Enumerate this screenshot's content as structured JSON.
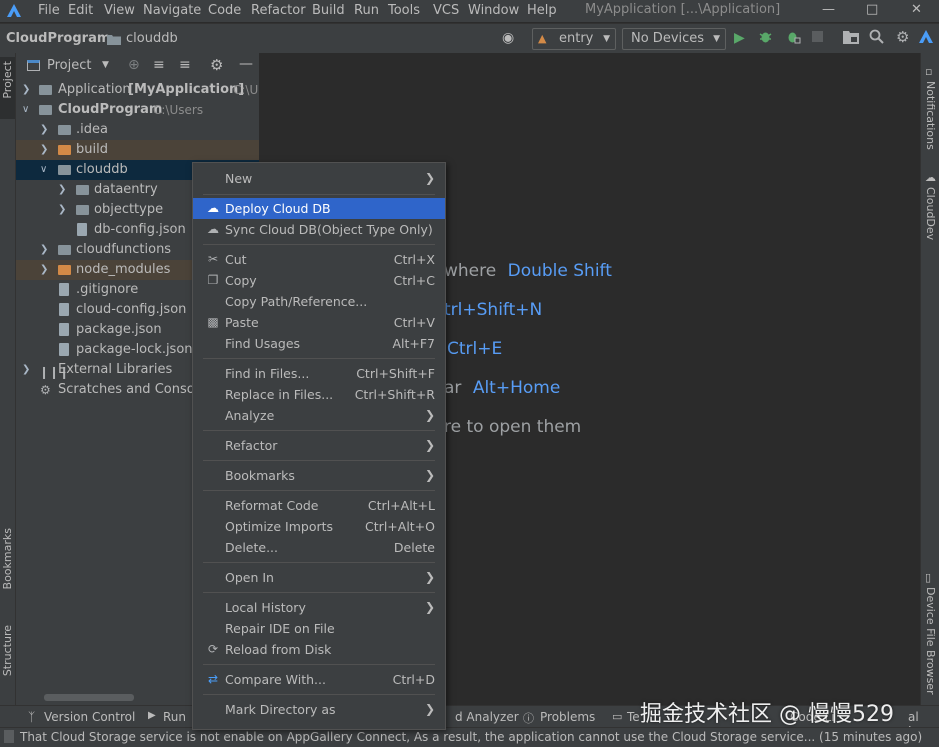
{
  "titlebar": {
    "menus": [
      "File",
      "Edit",
      "View",
      "Navigate",
      "Code",
      "Refactor",
      "Build",
      "Run",
      "Tools",
      "VCS",
      "Window",
      "Help"
    ],
    "window_title": "MyApplication [...\\Application]"
  },
  "navbar": {
    "project": "CloudProgram",
    "folder": "clouddb",
    "run_config": "entry",
    "device": "No Devices"
  },
  "left_strip": {
    "project": "Project",
    "bookmarks": "Bookmarks",
    "structure": "Structure"
  },
  "right_strip": {
    "notifications": "Notifications",
    "clouddev": "CloudDev",
    "device_file_browser": "Device File Browser"
  },
  "project_panel": {
    "title": "Project",
    "tree": [
      {
        "label": "Application",
        "bold": "[MyApplication]",
        "note": "C:\\U"
      },
      {
        "label": "CloudProgram",
        "note": "C:\\Users"
      },
      {
        "label": ".idea"
      },
      {
        "label": "build"
      },
      {
        "label": "clouddb"
      },
      {
        "label": "dataentry"
      },
      {
        "label": "objecttype"
      },
      {
        "label": "db-config.json"
      },
      {
        "label": "cloudfunctions"
      },
      {
        "label": "node_modules"
      },
      {
        "label": ".gitignore"
      },
      {
        "label": "cloud-config.json"
      },
      {
        "label": "package.json"
      },
      {
        "label": "package-lock.json"
      },
      {
        "label": "External Libraries"
      },
      {
        "label": "Scratches and Consoles"
      }
    ]
  },
  "editor_hints": [
    {
      "text": "where",
      "key": "Double Shift"
    },
    {
      "text": "trl+Shift+N",
      "key": ""
    },
    {
      "text": "Ctrl+E",
      "key": ""
    },
    {
      "text": "ar",
      "key": "Alt+Home"
    },
    {
      "text": "re to open them",
      "key": ""
    }
  ],
  "context_menu": {
    "items": [
      {
        "label": "New",
        "shortcut": ""
      },
      {
        "label": "Deploy Cloud DB",
        "shortcut": ""
      },
      {
        "label": "Sync Cloud DB(Object Type Only)",
        "shortcut": ""
      },
      {
        "label": "Cut",
        "shortcut": "Ctrl+X"
      },
      {
        "label": "Copy",
        "shortcut": "Ctrl+C"
      },
      {
        "label": "Copy Path/Reference...",
        "shortcut": ""
      },
      {
        "label": "Paste",
        "shortcut": "Ctrl+V"
      },
      {
        "label": "Find Usages",
        "shortcut": "Alt+F7"
      },
      {
        "label": "Find in Files...",
        "shortcut": "Ctrl+Shift+F"
      },
      {
        "label": "Replace in Files...",
        "shortcut": "Ctrl+Shift+R"
      },
      {
        "label": "Analyze",
        "shortcut": ""
      },
      {
        "label": "Refactor",
        "shortcut": ""
      },
      {
        "label": "Bookmarks",
        "shortcut": ""
      },
      {
        "label": "Reformat Code",
        "shortcut": "Ctrl+Alt+L"
      },
      {
        "label": "Optimize Imports",
        "shortcut": "Ctrl+Alt+O"
      },
      {
        "label": "Delete...",
        "shortcut": "Delete"
      },
      {
        "label": "Open In",
        "shortcut": ""
      },
      {
        "label": "Local History",
        "shortcut": ""
      },
      {
        "label": "Repair IDE on File",
        "shortcut": ""
      },
      {
        "label": "Reload from Disk",
        "shortcut": ""
      },
      {
        "label": "Compare With...",
        "shortcut": "Ctrl+D"
      },
      {
        "label": "Mark Directory as",
        "shortcut": ""
      }
    ]
  },
  "bottom_toolbar": {
    "version_control": "Version Control",
    "run": "Run",
    "analyzer": "d Analyzer",
    "problems": "Problems",
    "terminal_partial": "Te",
    "code_linter_partial": "Code Li",
    "tail_partial": "al Ins"
  },
  "status": "That Cloud Storage service is not enable on AppGallery Connect, As a result, the application cannot use the Cloud Storage service... (15 minutes ago)",
  "watermark": "掘金技术社区 @ 慢慢529",
  "colors": {
    "accent_blue": "#2f65ca",
    "selection": "#0d293e",
    "key_blue": "#589df6",
    "excluded": "#4b4339",
    "folder_blue": "#87939a",
    "folder_orange": "#d38a47"
  }
}
